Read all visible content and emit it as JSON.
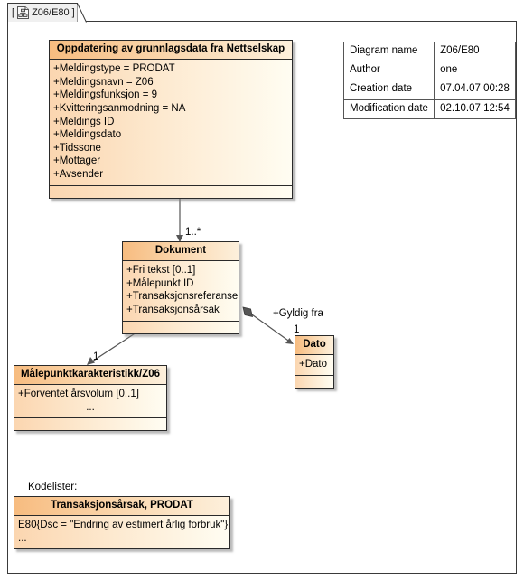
{
  "tab": {
    "bracket_open": "[",
    "bracket_close": "]",
    "label": "Z06/E80",
    "icon": "class-diagram-icon"
  },
  "info_table": {
    "rows": [
      {
        "key": "Diagram name",
        "value": "Z06/E80"
      },
      {
        "key": "Author",
        "value": "one"
      },
      {
        "key": "Creation date",
        "value": "07.04.07 00:28"
      },
      {
        "key": "Modification date",
        "value": "02.10.07 12:54"
      }
    ]
  },
  "classes": {
    "oppdatering": {
      "title": "Oppdatering av grunnlagsdata fra Nettselskap",
      "attributes": [
        "+Meldingstype = PRODAT",
        "+Meldingsnavn = Z06",
        "+Meldingsfunksjon = 9",
        "+Kvitteringsanmodning = NA",
        "+Meldings ID",
        "+Meldingsdato",
        "+Tidssone",
        "+Mottager",
        "+Avsender"
      ]
    },
    "dokument": {
      "title": "Dokument",
      "attributes": [
        "+Fri tekst [0..1]",
        "+Målepunkt ID",
        "+Transaksjonsreferanse",
        "+Transaksjonsårsak"
      ]
    },
    "malepunkt": {
      "title": "Målepunktkarakteristikk/Z06",
      "attributes": [
        "+Forventet årsvolum [0..1]",
        "..."
      ]
    },
    "dato": {
      "title": "Dato",
      "attributes": [
        "+Dato"
      ]
    },
    "kodeliste": {
      "title": "Transaksjonsårsak, PRODAT",
      "attributes": [
        "E80{Dsc = \"Endring av estimert årlig forbruk\"}",
        "..."
      ]
    }
  },
  "labels": {
    "kodelister_heading": "Kodelister:",
    "mult_dokument": "1..*",
    "mult_malepunkt": "1",
    "mult_dato": "1",
    "role_gyldig_fra": "+Gyldig fra"
  },
  "colors": {
    "class_fill_left": "#fbd6b0",
    "class_fill_right": "#fffdf2",
    "class_header_left": "#f7bc80",
    "border": "#2a2a2a",
    "canvas_border": "#3a3a3a",
    "connector": "#555555"
  }
}
